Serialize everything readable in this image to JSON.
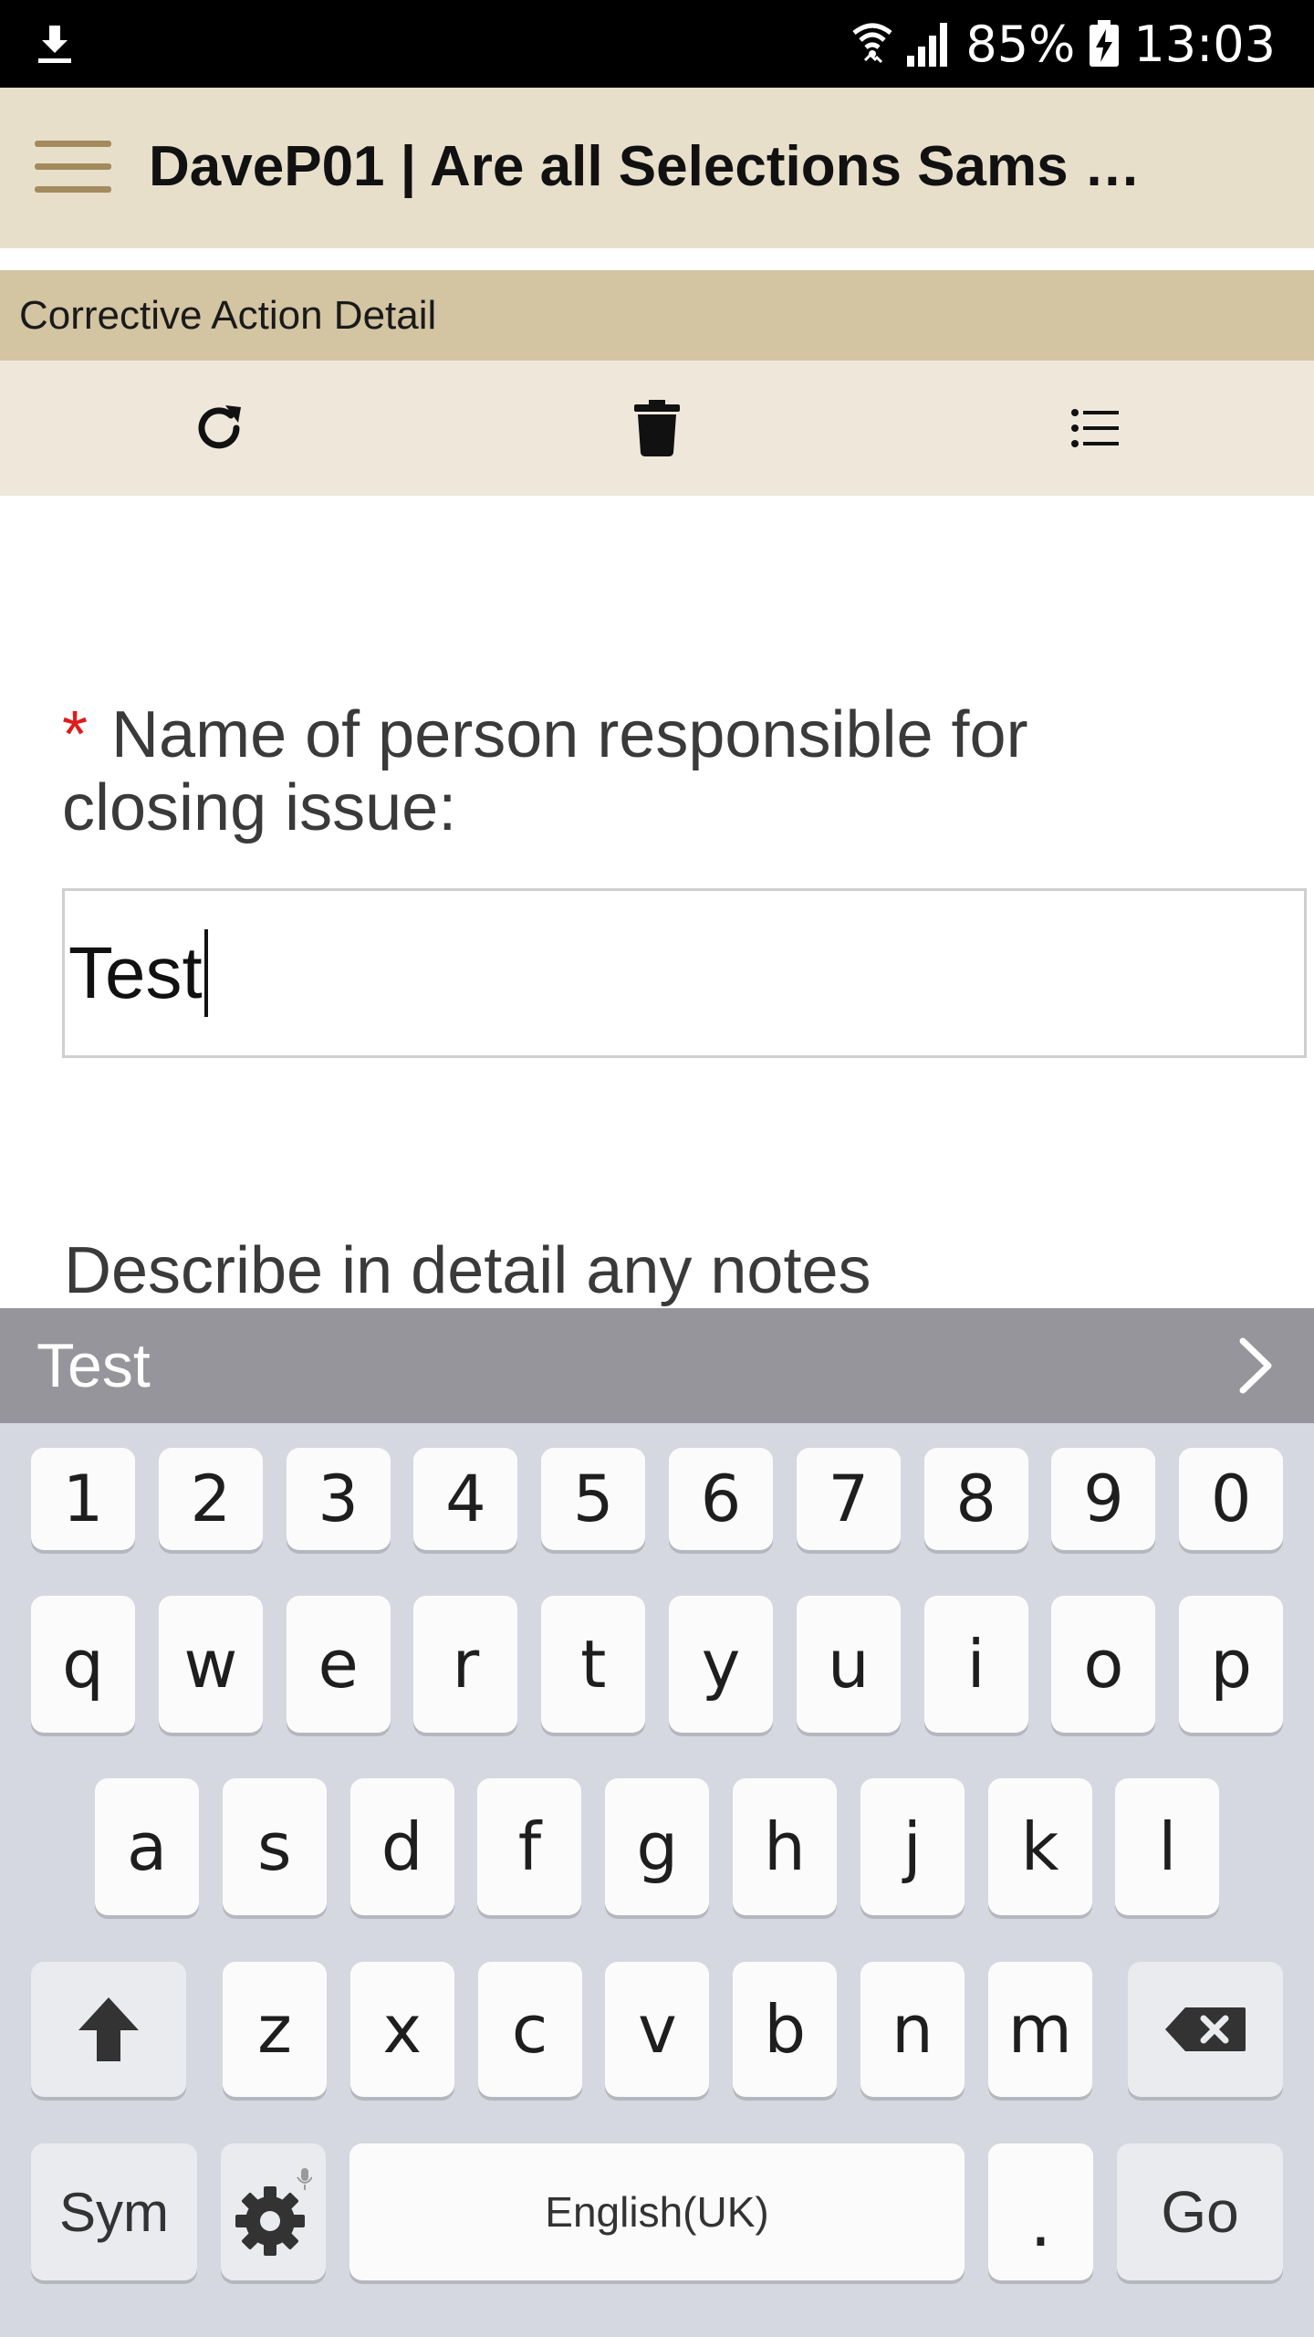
{
  "status_bar": {
    "battery": "85%",
    "time": "13:03",
    "icons": [
      "download-icon",
      "wifi-icon",
      "signal-icon",
      "battery-charging-icon"
    ]
  },
  "app_bar": {
    "title": "DaveP01 | Are all Selections Sams …",
    "menu_icon": "hamburger-menu-icon"
  },
  "section": {
    "title": "Corrective Action Detail"
  },
  "toolbar": {
    "icons": [
      "refresh-icon",
      "trash-icon",
      "list-icon"
    ]
  },
  "form": {
    "required_marker": "*",
    "responsible_label": "Name of person responsible for closing issue:",
    "responsible_value": "Test",
    "notes_label": "Describe in detail any notes"
  },
  "suggestions": {
    "word": "Test"
  },
  "keyboard": {
    "number_row": [
      "1",
      "2",
      "3",
      "4",
      "5",
      "6",
      "7",
      "8",
      "9",
      "0"
    ],
    "row1": [
      "q",
      "w",
      "e",
      "r",
      "t",
      "y",
      "u",
      "i",
      "o",
      "p"
    ],
    "row2": [
      "a",
      "s",
      "d",
      "f",
      "g",
      "h",
      "j",
      "k",
      "l"
    ],
    "row3": [
      "z",
      "x",
      "c",
      "v",
      "b",
      "n",
      "m"
    ],
    "sym_label": "Sym",
    "space_label": "English(UK)",
    "period_label": ".",
    "go_label": "Go"
  },
  "colors": {
    "app_bar_bg": "#e8dfcb",
    "section_bg": "#d3c4a2",
    "toolbar_bg": "#efe8da",
    "hamburger": "#a38b5e",
    "required": "#e01b1b",
    "suggestion_bar": "#96959c",
    "keyboard_bg": "#d5d8e0"
  }
}
